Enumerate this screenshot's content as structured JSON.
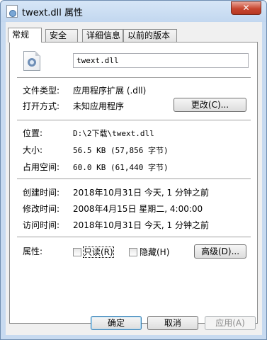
{
  "window": {
    "title": "twext.dll 属性",
    "close_label": "✕"
  },
  "tabs": [
    "常规",
    "安全",
    "详细信息",
    "以前的版本"
  ],
  "general": {
    "file_name": "twext.dll",
    "file_type_label": "文件类型:",
    "file_type_value": "应用程序扩展 (.dll)",
    "opens_with_label": "打开方式:",
    "opens_with_value": "未知应用程序",
    "change_button": "更改(C)...",
    "location_label": "位置:",
    "location_value": "D:\\2下载\\twext.dll",
    "size_label": "大小:",
    "size_value": "56.5 KB (57,856 字节)",
    "size_on_disk_label": "占用空间:",
    "size_on_disk_value": "60.0 KB (61,440 字节)",
    "created_label": "创建时间:",
    "created_value": "2018年10月31日 今天, 1 分钟之前",
    "modified_label": "修改时间:",
    "modified_value": "2008年4月15日 星期二, 4:00:00",
    "accessed_label": "访问时间:",
    "accessed_value": "2018年10月31日 今天, 1 分钟之前",
    "attributes_label": "属性:",
    "readonly_label": "只读(R)",
    "readonly_checked": false,
    "hidden_label": "隐藏(H)",
    "hidden_checked": false,
    "advanced_button": "高级(D)..."
  },
  "footer": {
    "ok": "确定",
    "cancel": "取消",
    "apply": "应用(A)"
  }
}
